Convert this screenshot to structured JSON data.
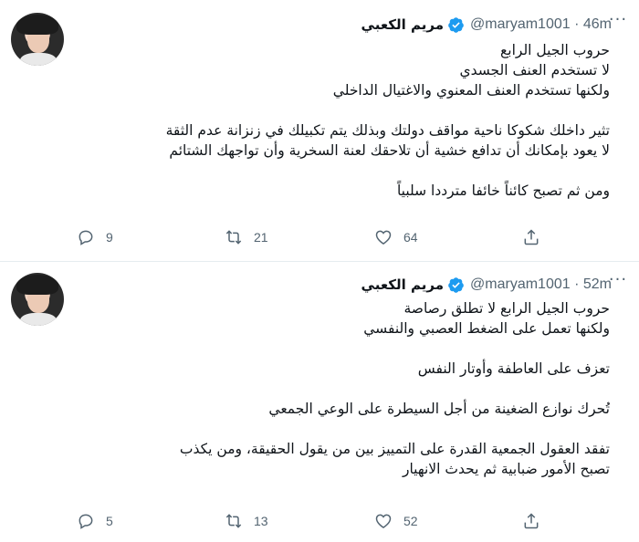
{
  "tweets": [
    {
      "display_name": "مريم الكعبي",
      "handle_time": "@maryam1001 · 46m",
      "lines": [
        "حروب الجيل الرابع",
        "لا تستخدم العنف الجسدي",
        "ولكنها تستخدم العنف المعنوي والاغتيال الداخلي",
        "",
        "تثير داخلك  شكوكا ناحية مواقف دولتك وبذلك يتم تكبيلك في زنزانة عدم الثقة",
        "لا يعود بإمكانك أن تدافع خشية أن تلاحقك لعنة السخرية وأن تواجهك الشتائم",
        "",
        "ومن ثم تصبح كائناً خائفا مترددا سلبياً"
      ],
      "replies": "9",
      "retweets": "21",
      "likes": "64"
    },
    {
      "display_name": "مريم الكعبي",
      "handle_time": "@maryam1001 · 52m",
      "lines": [
        "حروب الجيل الرابع لا تطلق رصاصة",
        "ولكنها تعمل على الضغط العصبي والنفسي",
        "",
        "تعزف على العاطفة وأوتار النفس",
        "",
        "تُحرك نوازع الضغينة من أجل السيطرة على الوعي الجمعي",
        "",
        "تفقد العقول الجمعية القدرة على التمييز بين من يقول الحقيقة، ومن يكذب",
        "تصبح الأمور ضبابية ثم يحدث الانهيار"
      ],
      "replies": "5",
      "retweets": "13",
      "likes": "52"
    }
  ],
  "icons": {
    "more": "more-horizontal-icon",
    "verified": "verified-badge-icon",
    "reply": "reply-icon",
    "retweet": "retweet-icon",
    "like": "heart-icon",
    "share": "share-icon"
  },
  "colors": {
    "verified": "#1d9bf0",
    "secondary_text": "#536471",
    "divider": "#e6ecf0"
  }
}
